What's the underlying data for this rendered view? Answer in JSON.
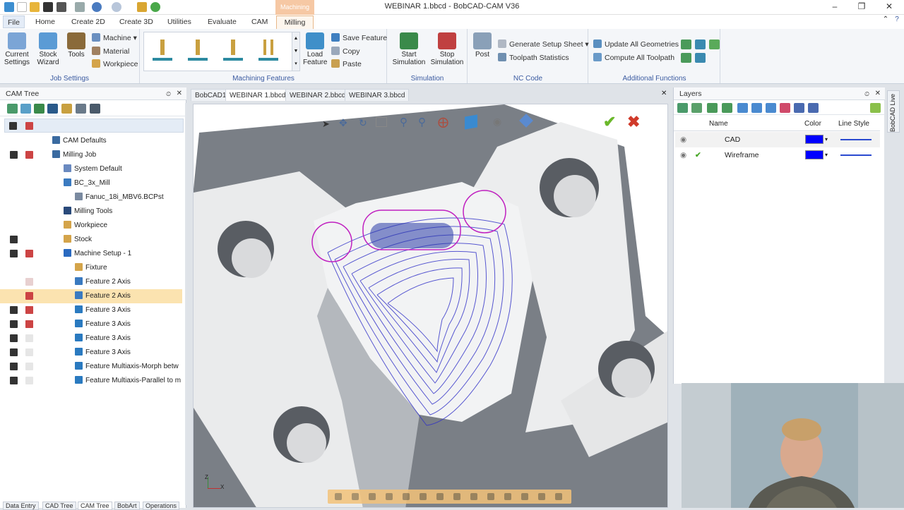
{
  "window": {
    "title": "WEBINAR 1.bbcd - BobCAD-CAM V36"
  },
  "menu": {
    "context_label": "Machining",
    "tabs": [
      "File",
      "Home",
      "Create 2D",
      "Create 3D",
      "Utilities",
      "Evaluate",
      "CAM",
      "Milling"
    ],
    "active_tab": "Milling"
  },
  "ribbon": {
    "job_settings": {
      "label": "Job Settings",
      "current_settings": "Current Settings",
      "stock_wizard": "Stock Wizard",
      "tools": "Tools",
      "machine": "Machine",
      "material": "Material",
      "workpiece": "Workpiece"
    },
    "machining_features": {
      "label": "Machining Features",
      "load_feature": "Load Feature",
      "save_feature": "Save Feature",
      "copy": "Copy",
      "paste": "Paste"
    },
    "simulation": {
      "label": "Simulation",
      "start": "Start Simulation",
      "stop": "Stop Simulation"
    },
    "nc_code": {
      "label": "NC Code",
      "post": "Post",
      "setup_sheet": "Generate Setup Sheet",
      "toolpath_stats": "Toolpath Statistics"
    },
    "additional": {
      "label": "Additional Functions",
      "update_geom": "Update All Geometries",
      "compute_toolpath": "Compute All Toolpath"
    }
  },
  "cam_tree": {
    "title": "CAM Tree",
    "items": [
      {
        "label": "CAM Defaults",
        "indent": 1
      },
      {
        "label": "Milling Job",
        "indent": 1
      },
      {
        "label": "System Default",
        "indent": 2
      },
      {
        "label": "BC_3x_Mill",
        "indent": 2
      },
      {
        "label": "Fanuc_18i_MBV6.BCPst",
        "indent": 3
      },
      {
        "label": "Milling Tools",
        "indent": 2
      },
      {
        "label": "Workpiece",
        "indent": 2
      },
      {
        "label": "Stock",
        "indent": 2
      },
      {
        "label": "Machine Setup - 1",
        "indent": 2
      },
      {
        "label": "Fixture",
        "indent": 3
      },
      {
        "label": "Feature 2 Axis",
        "indent": 3
      },
      {
        "label": "Feature 2 Axis",
        "indent": 3,
        "selected": true
      },
      {
        "label": "Feature 3 Axis",
        "indent": 3
      },
      {
        "label": "Feature 3 Axis",
        "indent": 3
      },
      {
        "label": "Feature 3 Axis",
        "indent": 3
      },
      {
        "label": "Feature 3 Axis",
        "indent": 3
      },
      {
        "label": "Feature Multiaxis-Morph betw",
        "indent": 3
      },
      {
        "label": "Feature Multiaxis-Parallel to m",
        "indent": 3
      }
    ]
  },
  "doc_tabs": [
    "BobCAD1",
    "WEBINAR 1.bbcd",
    "WEBINAR 2.bbcd",
    "WEBINAR 3.bbcd"
  ],
  "active_doc": "WEBINAR 1.bbcd",
  "layers": {
    "title": "Layers",
    "columns": [
      "Name",
      "Color",
      "Line Style"
    ],
    "rows": [
      {
        "name": "CAD",
        "color": "#0000ff"
      },
      {
        "name": "Wireframe",
        "color": "#0000ff"
      }
    ]
  },
  "side_tab": "BobCAD Live",
  "bottom_tabs": [
    "Data Entry",
    "CAD Tree",
    "CAM Tree",
    "BobArt",
    "Operations"
  ],
  "active_bottom_tab": "CAM Tree",
  "axis_labels": {
    "x": "X",
    "z": "Z"
  }
}
